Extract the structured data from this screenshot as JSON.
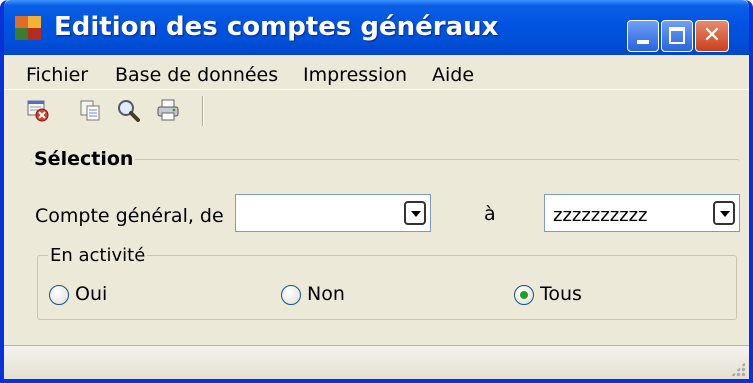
{
  "window": {
    "title": "Edition des comptes généraux"
  },
  "menu": {
    "items": [
      "Fichier",
      "Base de données",
      "Impression",
      "Aide"
    ]
  },
  "toolbar": {
    "icons": [
      "delete-record-icon",
      "copy-icon",
      "preview-magnifier-icon",
      "print-icon"
    ]
  },
  "selection": {
    "group_title": "Sélection",
    "account_label": "Compte général, de",
    "from_value": "",
    "to_label": "à",
    "to_value": "zzzzzzzzzz"
  },
  "activity": {
    "group_title": "En activité",
    "options": [
      {
        "label": "Oui",
        "checked": false
      },
      {
        "label": "Non",
        "checked": false
      },
      {
        "label": "Tous",
        "checked": true
      }
    ]
  },
  "colors": {
    "titlebar": "#0053e0",
    "window_bg": "#ece9d8",
    "radio_selected": "#21a121"
  }
}
